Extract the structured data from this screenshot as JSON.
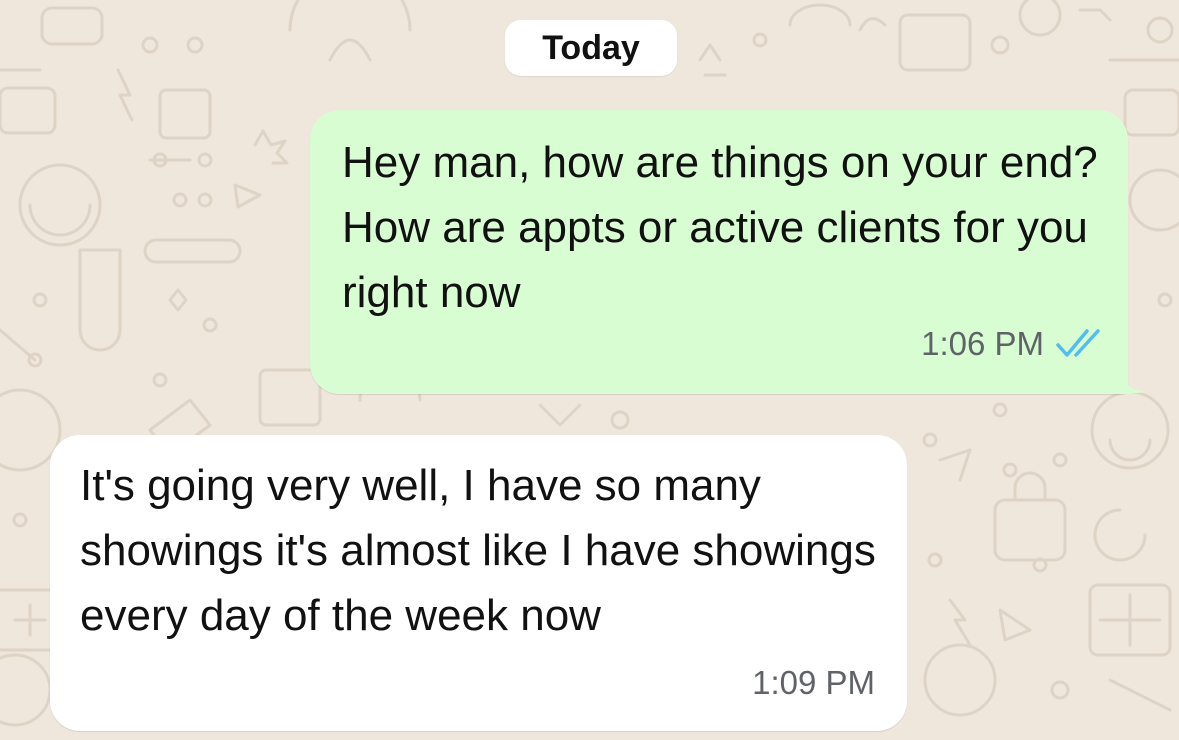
{
  "chat": {
    "date_label": "Today",
    "messages": [
      {
        "direction": "outgoing",
        "text": "Hey man, how are things on your end? How are appts or active clients for you right now",
        "time": "1:06 PM",
        "status": "read",
        "status_icon": "double-check-icon"
      },
      {
        "direction": "incoming",
        "text": "It's going very well, I have so many showings it's almost like I have showings every day of the week now",
        "time": "1:09 PM"
      }
    ]
  },
  "colors": {
    "wallpaper": "#efe7dc",
    "outgoing_bubble": "#d9fdd3",
    "incoming_bubble": "#ffffff",
    "read_ticks": "#53bdeb",
    "timestamp": "#5f6368"
  }
}
